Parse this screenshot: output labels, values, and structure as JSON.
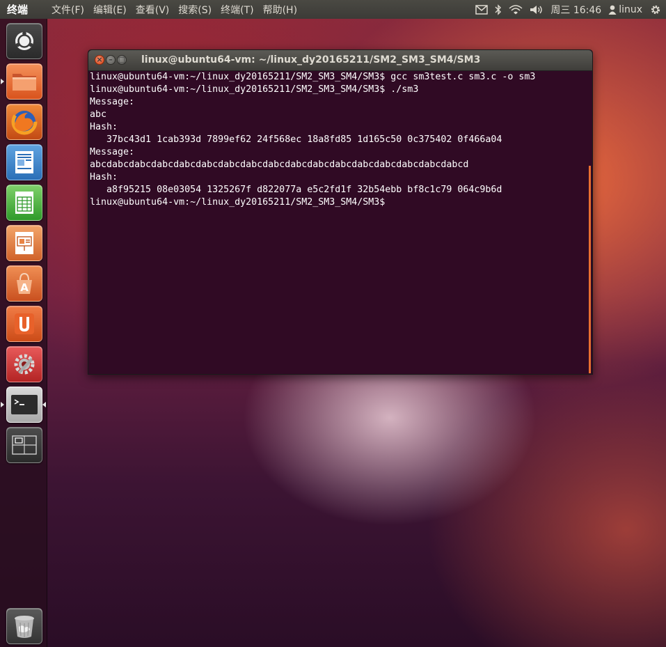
{
  "top_panel": {
    "app_title": "终端",
    "menu": [
      "文件(F)",
      "编辑(E)",
      "查看(V)",
      "搜索(S)",
      "终端(T)",
      "帮助(H)"
    ],
    "clock": "周三 16:46",
    "user": "linux",
    "indicator_icons": [
      "mail-icon",
      "bluetooth-icon",
      "wifi-icon",
      "volume-icon",
      "user-icon",
      "gear-icon"
    ]
  },
  "launcher": {
    "items": [
      {
        "name": "dash-home",
        "icon": "ubuntu-logo-icon"
      },
      {
        "name": "home-folder",
        "icon": "folder-icon"
      },
      {
        "name": "firefox",
        "icon": "firefox-icon"
      },
      {
        "name": "libreoffice-writer",
        "icon": "writer-icon"
      },
      {
        "name": "libreoffice-calc",
        "icon": "calc-icon"
      },
      {
        "name": "libreoffice-impress",
        "icon": "impress-icon"
      },
      {
        "name": "ubuntu-software-center",
        "icon": "software-center-icon"
      },
      {
        "name": "ubuntu-one",
        "icon": "ubuntu-one-icon"
      },
      {
        "name": "system-settings",
        "icon": "settings-icon"
      },
      {
        "name": "terminal",
        "icon": "terminal-icon",
        "running": true,
        "active": true
      },
      {
        "name": "workspace-switcher",
        "icon": "workspace-icon"
      },
      {
        "name": "trash",
        "icon": "trash-icon"
      }
    ]
  },
  "terminal": {
    "title": "linux@ubuntu64-vm: ~/linux_dy20165211/SM2_SM3_SM4/SM3",
    "lines": [
      "linux@ubuntu64-vm:~/linux_dy20165211/SM2_SM3_SM4/SM3$ gcc sm3test.c sm3.c -o sm3",
      "linux@ubuntu64-vm:~/linux_dy20165211/SM2_SM3_SM4/SM3$ ./sm3",
      "Message:",
      "abc",
      "Hash:",
      "   37bc43d1 1cab393d 7899ef62 24f568ec 18a8fd85 1d165c50 0c375402 0f466a04",
      "Message:",
      "abcdabcdabcdabcdabcdabcdabcdabcdabcdabcdabcdabcdabcdabcdabcdabcdabcd",
      "Hash:",
      "   a8f95215 08e03054 1325267f d822077a e5c2fd1f 32b54ebb bf8c1c79 064c9b6d",
      "linux@ubuntu64-vm:~/linux_dy20165211/SM2_SM3_SM4/SM3$"
    ]
  },
  "colors": {
    "terminal_bg": "#300a24",
    "accent_orange": "#e86f30",
    "panel_bg": "#3c3b37"
  }
}
